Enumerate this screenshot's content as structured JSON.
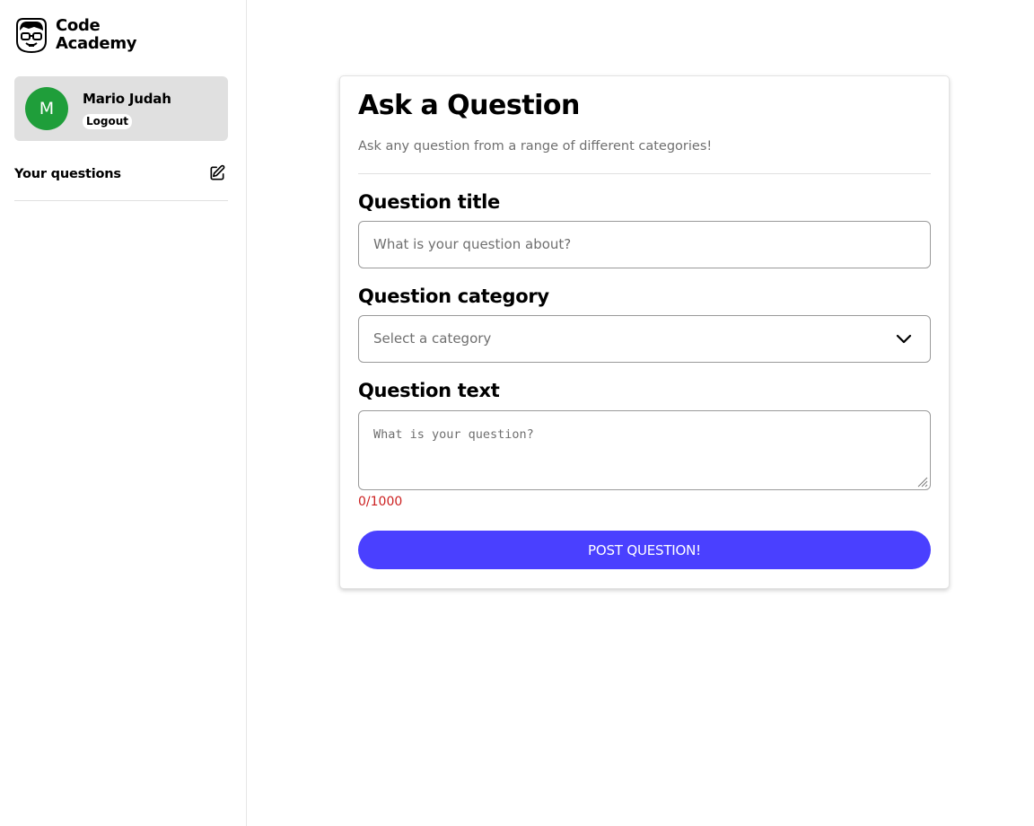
{
  "brand": {
    "line1": "Code",
    "line2": "Academy",
    "logo_icon": "nerd-face-logo-icon"
  },
  "user": {
    "initial": "M",
    "name": "Mario Judah",
    "logout_label": "Logout",
    "avatar_color": "#1f9e3a"
  },
  "sidebar": {
    "your_questions_label": "Your questions",
    "edit_icon": "edit-icon"
  },
  "form": {
    "title": "Ask a Question",
    "subtitle": "Ask any question from a range of different categories!",
    "question_title_label": "Question title",
    "question_title_placeholder": "What is your question about?",
    "question_category_label": "Question category",
    "question_category_value": "Select a category",
    "question_text_label": "Question text",
    "question_text_placeholder": "What is your question?",
    "char_counter": "0/1000",
    "submit_label": "POST QUESTION!"
  },
  "colors": {
    "accent": "#4a40ff",
    "counter_color": "#cc1f1f",
    "user_card_bg": "#e0e0e0"
  }
}
